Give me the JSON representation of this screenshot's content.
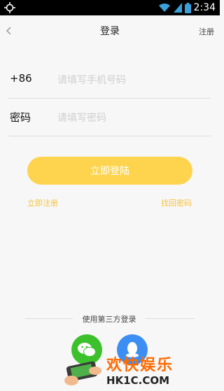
{
  "status_bar": {
    "time": "2:34"
  },
  "header": {
    "title": "登录",
    "register_label": "注册"
  },
  "form": {
    "phone": {
      "prefix": "+86",
      "placeholder": "请填写手机号码",
      "value": ""
    },
    "password": {
      "label": "密码",
      "placeholder": "请填写密码",
      "value": ""
    }
  },
  "actions": {
    "login_label": "立即登陆",
    "register_now_label": "立即注册",
    "forgot_password_label": "找回密码"
  },
  "third_party": {
    "title": "使用第三方登录",
    "providers": [
      "wechat-icon",
      "qq-icon"
    ]
  },
  "watermark": {
    "text_cn": "欢快娱乐",
    "text_en": "HK1C.COM"
  },
  "colors": {
    "accent": "#fed44f",
    "link": "#f4c33a",
    "wechat": "#3cc12c",
    "qq": "#3d8ef3"
  }
}
